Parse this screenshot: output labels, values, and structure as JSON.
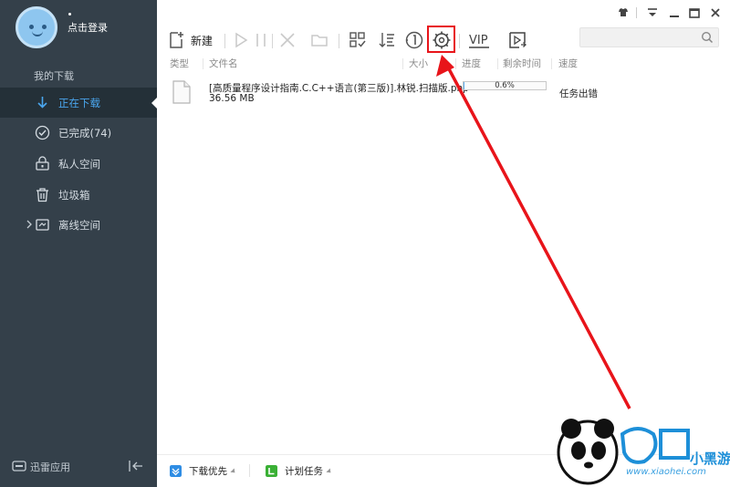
{
  "sidebar": {
    "login_text": "点击登录",
    "section_title": "我的下载",
    "items": [
      {
        "label": "正在下载",
        "icon": "download-arrow-icon"
      },
      {
        "label": "已完成(74)",
        "icon": "check-circle-icon"
      },
      {
        "label": "私人空间",
        "icon": "lock-icon"
      },
      {
        "label": "垃圾箱",
        "icon": "trash-icon"
      },
      {
        "label": "离线空间",
        "icon": "cloud-file-icon"
      }
    ],
    "app_label": "迅雷应用"
  },
  "toolbar": {
    "new_label": "新建",
    "vip_label": "VIP"
  },
  "columns": [
    "类型",
    "文件名",
    "大小",
    "进度",
    "剩余时间",
    "速度"
  ],
  "download_row": {
    "file_name": "[高质量程序设计指南.C.C++语言(第三版)].林锐.扫描版.php",
    "size": "36.56 MB",
    "progress_text": "0.6%",
    "progress_value": 0.006,
    "status": "任务出错"
  },
  "bottom_bar": {
    "priority_label": "下载优先",
    "schedule_label": "计划任务"
  },
  "colors": {
    "sidebar_bg": "#34404a",
    "active_item_bg": "#243038",
    "accent_blue": "#4aa6ee",
    "highlight_red": "#e8141a"
  },
  "watermark": {
    "title": "小黑游戏",
    "url": "www.xiaohei.com"
  }
}
